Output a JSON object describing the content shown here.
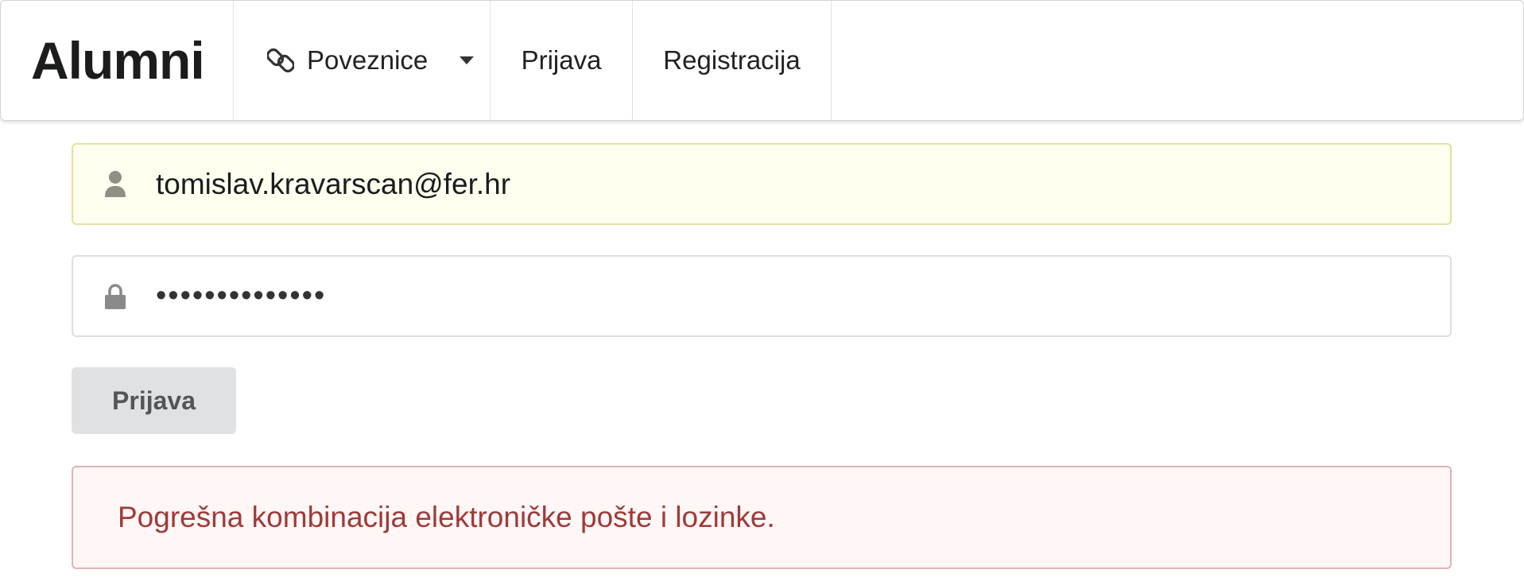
{
  "nav": {
    "brand": "Alumni",
    "links_label": "Poveznice",
    "links_icon": "chain-link-icon",
    "login_label": "Prijava",
    "register_label": "Registracija"
  },
  "form": {
    "email_value": "tomislav.kravarscan@fer.hr",
    "email_icon": "user-icon",
    "password_value": "••••••••••••••",
    "password_icon": "lock-icon",
    "submit_label": "Prijava"
  },
  "error": {
    "message": "Pogrešna kombinacija elektroničke pošte i lozinke."
  },
  "colors": {
    "email_bg": "#fffff0",
    "error_bg": "#fff6f6",
    "error_text": "#9f3a38",
    "button_bg": "#e0e1e2"
  }
}
